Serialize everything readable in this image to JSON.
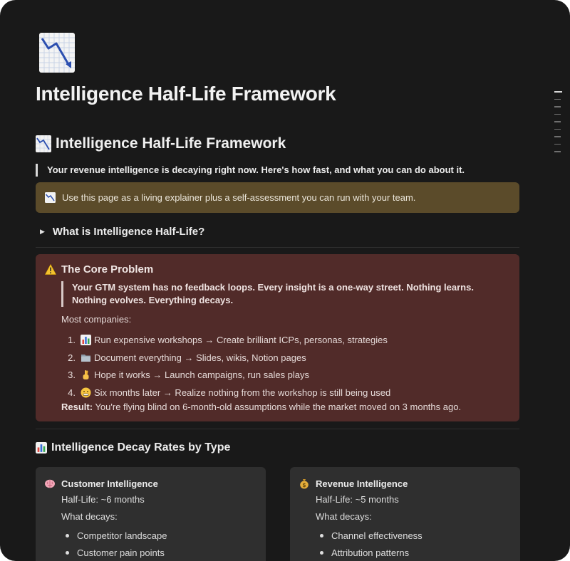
{
  "page": {
    "title": "Intelligence Half-Life Framework",
    "page_icon": "chart-decreasing-icon"
  },
  "heading": {
    "icon": "chart-decreasing-icon",
    "text": "Intelligence Half-Life Framework"
  },
  "intro_quote": "Your revenue intelligence is decaying right now. Here's how fast, and what you can do about it.",
  "info_callout": {
    "icon": "chart-decreasing-icon",
    "text": "Use this page as a living explainer plus a self-assessment you can run with your team.",
    "color": "#5b4b2a"
  },
  "toggle": {
    "label": "What is Intelligence Half-Life?"
  },
  "core_problem": {
    "icon": "warning-icon",
    "title": "The Core Problem",
    "quote": "Your GTM system has no feedback loops. Every insight is a one-way street. Nothing learns. Nothing evolves. Everything decays.",
    "lead": "Most companies:",
    "steps": [
      {
        "num": "1.",
        "icon": "bar-chart-icon",
        "text": "Run expensive workshops → Create brilliant ICPs, personas, strategies"
      },
      {
        "num": "2.",
        "icon": "folder-icon",
        "text": "Document everything → Slides, wikis, Notion pages"
      },
      {
        "num": "3.",
        "icon": "crossed-fingers-icon",
        "text": "Hope it works → Launch campaigns, run sales plays"
      },
      {
        "num": "4.",
        "icon": "grimace-face-icon",
        "text": "Six months later → Realize nothing from the workshop is still being used"
      }
    ],
    "result_label": "Result:",
    "result_text": " You're flying blind on 6-month-old assumptions while the market moved on 3 months ago.",
    "color": "#512b29"
  },
  "decay_section": {
    "icon": "bar-chart-icon",
    "title": "Intelligence Decay Rates by Type"
  },
  "cards": [
    {
      "icon": "brain-icon",
      "title": "Customer Intelligence",
      "half_life": "Half-Life: ~6 months",
      "what_decays": "What decays:",
      "items": [
        "Competitor landscape",
        "Customer pain points"
      ]
    },
    {
      "icon": "money-bag-icon",
      "title": "Revenue Intelligence",
      "half_life": "Half-Life: ~5 months",
      "what_decays": "What decays:",
      "items": [
        "Channel effectiveness",
        "Attribution patterns"
      ]
    }
  ]
}
